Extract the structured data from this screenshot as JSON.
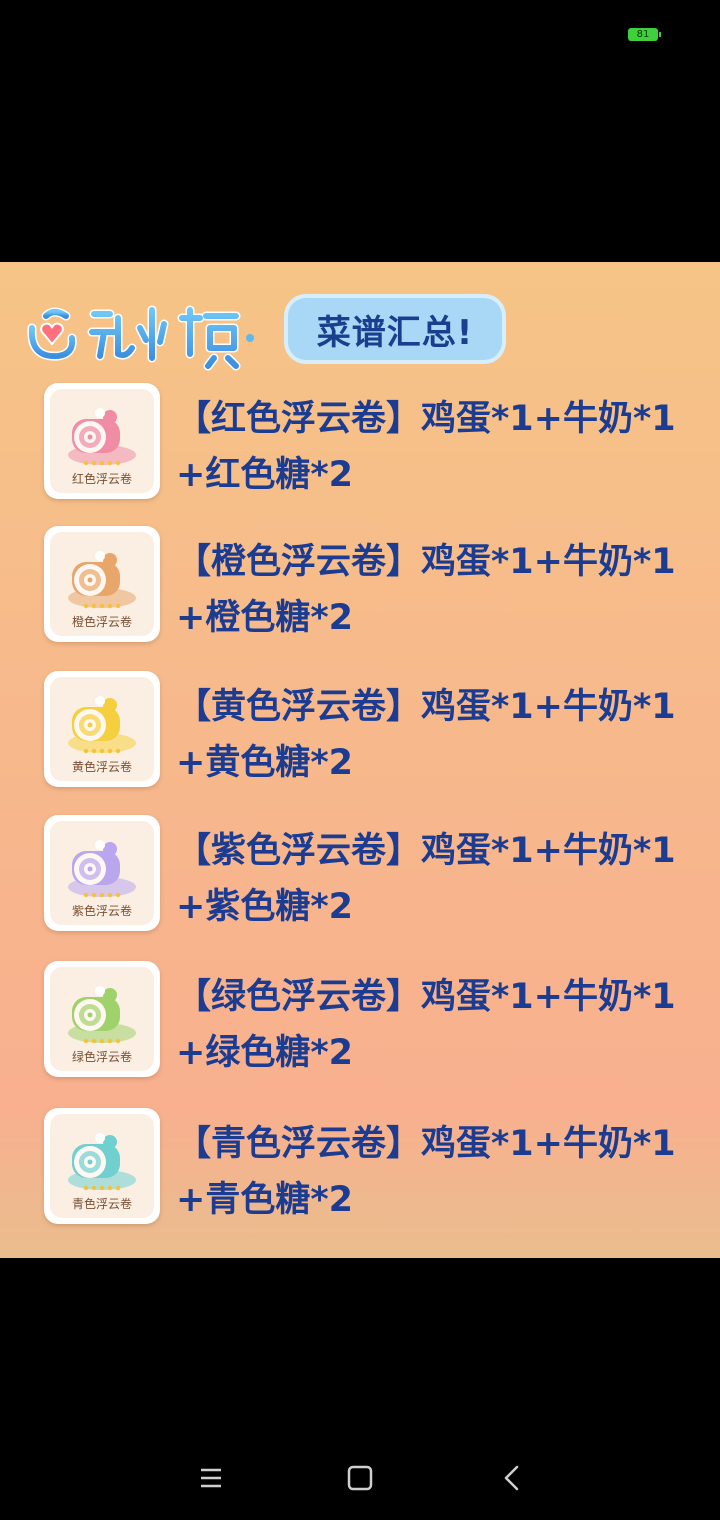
{
  "status_bar": {
    "battery": "81"
  },
  "header": {
    "logo_text": "心动小镇",
    "tag_label": "菜谱汇总!"
  },
  "recipes": [
    {
      "card_label": "红色浮云卷",
      "line1": "【红色浮云卷】鸡蛋*1+牛奶*1",
      "line2": "+红色糖*2",
      "color": "#f08ca4"
    },
    {
      "card_label": "橙色浮云卷",
      "line1": "【橙色浮云卷】鸡蛋*1+牛奶*1",
      "line2": "+橙色糖*2",
      "color": "#e8a66a"
    },
    {
      "card_label": "黄色浮云卷",
      "line1": "【黄色浮云卷】鸡蛋*1+牛奶*1",
      "line2": "+黄色糖*2",
      "color": "#f5cf3d"
    },
    {
      "card_label": "紫色浮云卷",
      "line1": "【紫色浮云卷】鸡蛋*1+牛奶*1",
      "line2": "+紫色糖*2",
      "color": "#b9a6ee"
    },
    {
      "card_label": "绿色浮云卷",
      "line1": "【绿色浮云卷】鸡蛋*1+牛奶*1",
      "line2": "+绿色糖*2",
      "color": "#9fd26a"
    },
    {
      "card_label": "青色浮云卷",
      "line1": "【青色浮云卷】鸡蛋*1+牛奶*1",
      "line2": "+青色糖*2",
      "color": "#6fd0cf"
    }
  ],
  "nav": {
    "menu_icon": "menu-icon",
    "home_icon": "home-icon",
    "back_icon": "back-icon"
  }
}
